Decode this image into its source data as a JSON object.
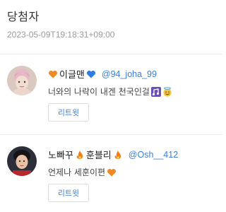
{
  "header": {
    "title": "당첨자",
    "timestamp": "2023-05-09T19:18:31+09:00"
  },
  "winners": [
    {
      "name_prefix_icon": "orange-heart-icon",
      "name": "이글맨",
      "name_suffix_icon": "blue-heart-icon",
      "handle": "@94_joha_99",
      "message": "너와의 나락이 내겐 천국인걸",
      "message_icons": [
        "musical-notes-icon",
        "smiling-face-with-halo-icon"
      ],
      "retweet_label": "리트윗"
    },
    {
      "name_part1": "노빠꾸",
      "name_icon1": "fire-icon",
      "name_part2": "훈블리",
      "name_icon2": "fire-icon",
      "handle": "@Osh__412",
      "message": "언제나 세훈이편",
      "message_icons": [
        "orange-heart-icon"
      ],
      "retweet_label": "리트윗"
    }
  ],
  "colors": {
    "accent": "#3d7fd9",
    "muted": "#9a9a9a",
    "divider": "#ececec"
  }
}
